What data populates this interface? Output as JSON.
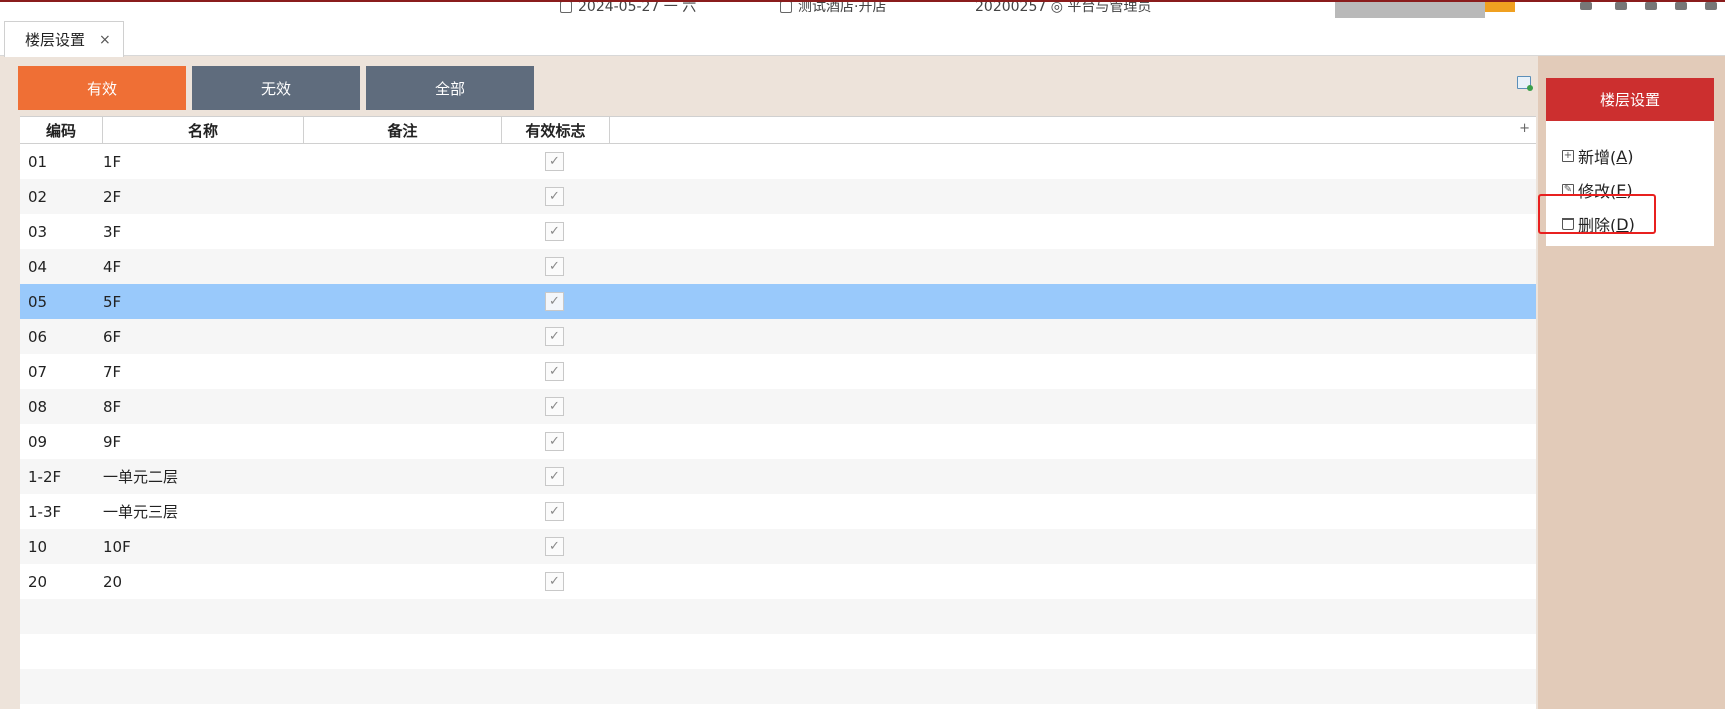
{
  "topbar": {
    "date_text": "2024-05-27 一 六",
    "hotel_text": "测试酒店·开店",
    "user_text": "20200257 ◎ 平台与管理员"
  },
  "tabs": [
    {
      "label": "楼层设置",
      "close": "×"
    }
  ],
  "filters": {
    "valid": "有效",
    "invalid": "无效",
    "all": "全部"
  },
  "grid": {
    "columns": [
      "编码",
      "名称",
      "备注",
      "有效标志"
    ],
    "sort_plus": "+",
    "rows": [
      {
        "code": "01",
        "name": "1F",
        "note": "",
        "valid": true
      },
      {
        "code": "02",
        "name": "2F",
        "note": "",
        "valid": true
      },
      {
        "code": "03",
        "name": "3F",
        "note": "",
        "valid": true
      },
      {
        "code": "04",
        "name": "4F",
        "note": "",
        "valid": true
      },
      {
        "code": "05",
        "name": "5F",
        "note": "",
        "valid": true
      },
      {
        "code": "06",
        "name": "6F",
        "note": "",
        "valid": true
      },
      {
        "code": "07",
        "name": "7F",
        "note": "",
        "valid": true
      },
      {
        "code": "08",
        "name": "8F",
        "note": "",
        "valid": true
      },
      {
        "code": "09",
        "name": "9F",
        "note": "",
        "valid": true
      },
      {
        "code": "1-2F",
        "name": "一单元二层",
        "note": "",
        "valid": true
      },
      {
        "code": "1-3F",
        "name": "一单元三层",
        "note": "",
        "valid": true
      },
      {
        "code": "10",
        "name": "10F",
        "note": "",
        "valid": true
      },
      {
        "code": "20",
        "name": "20",
        "note": "",
        "valid": true
      }
    ],
    "selected_code": "05",
    "check_glyph": "✓"
  },
  "side_panel": {
    "title": "楼层设置",
    "actions": [
      {
        "label": "新增(",
        "key": "A",
        "end": ")",
        "icon": "add-icon"
      },
      {
        "label": "修改(",
        "key": "E",
        "end": ")",
        "icon": "edit-icon"
      },
      {
        "label": "删除(",
        "key": "D",
        "end": ")",
        "icon": "trash-icon"
      }
    ]
  },
  "colors": {
    "active_filter": "#ef6f35",
    "inactive_filter": "#5f6c7d",
    "selected_row": "#99c9fb",
    "side_title": "#cc2f2f",
    "highlight": "#e8201f"
  }
}
